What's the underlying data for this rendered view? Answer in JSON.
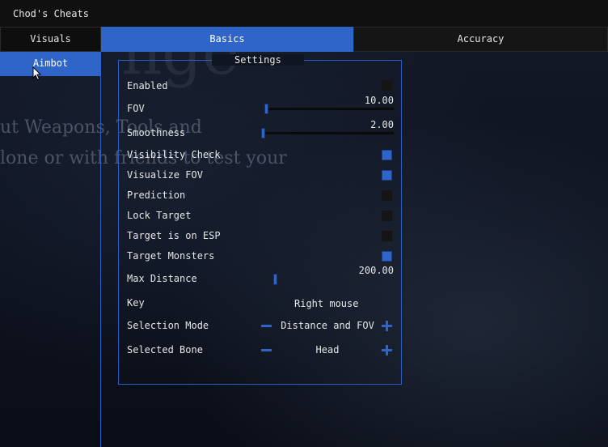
{
  "window": {
    "title": "Chod's Cheats"
  },
  "sidebar": {
    "tab_label": "Visuals",
    "items": [
      {
        "label": "Aimbot",
        "active": true
      }
    ]
  },
  "tabs": [
    {
      "label": "Basics",
      "active": true
    },
    {
      "label": "Accuracy",
      "active": false
    }
  ],
  "background_text": {
    "big": "nge",
    "line1": "ut Weapons, Tools and",
    "line2": "lone or with friends to test your"
  },
  "settings": {
    "title": "Settings",
    "enabled": {
      "label": "Enabled",
      "checked": false
    },
    "fov": {
      "label": "FOV",
      "value": "10.00"
    },
    "smoothness": {
      "label": "Smoothness",
      "value": "2.00"
    },
    "visibility_check": {
      "label": "Visibility Check",
      "checked": true
    },
    "visualize_fov": {
      "label": "Visualize FOV",
      "checked": true
    },
    "prediction": {
      "label": "Prediction",
      "checked": false
    },
    "lock_target": {
      "label": "Lock Target",
      "checked": false
    },
    "target_on_esp": {
      "label": "Target is on ESP",
      "checked": false
    },
    "target_monsters": {
      "label": "Target Monsters",
      "checked": true
    },
    "max_distance": {
      "label": "Max Distance",
      "value": "200.00"
    },
    "key": {
      "label": "Key",
      "value": "Right mouse"
    },
    "selection_mode": {
      "label": "Selection Mode",
      "value": "Distance and FOV"
    },
    "selected_bone": {
      "label": "Selected Bone",
      "value": "Head"
    }
  },
  "colors": {
    "accent": "#2f65c9",
    "panel": "#101010"
  }
}
